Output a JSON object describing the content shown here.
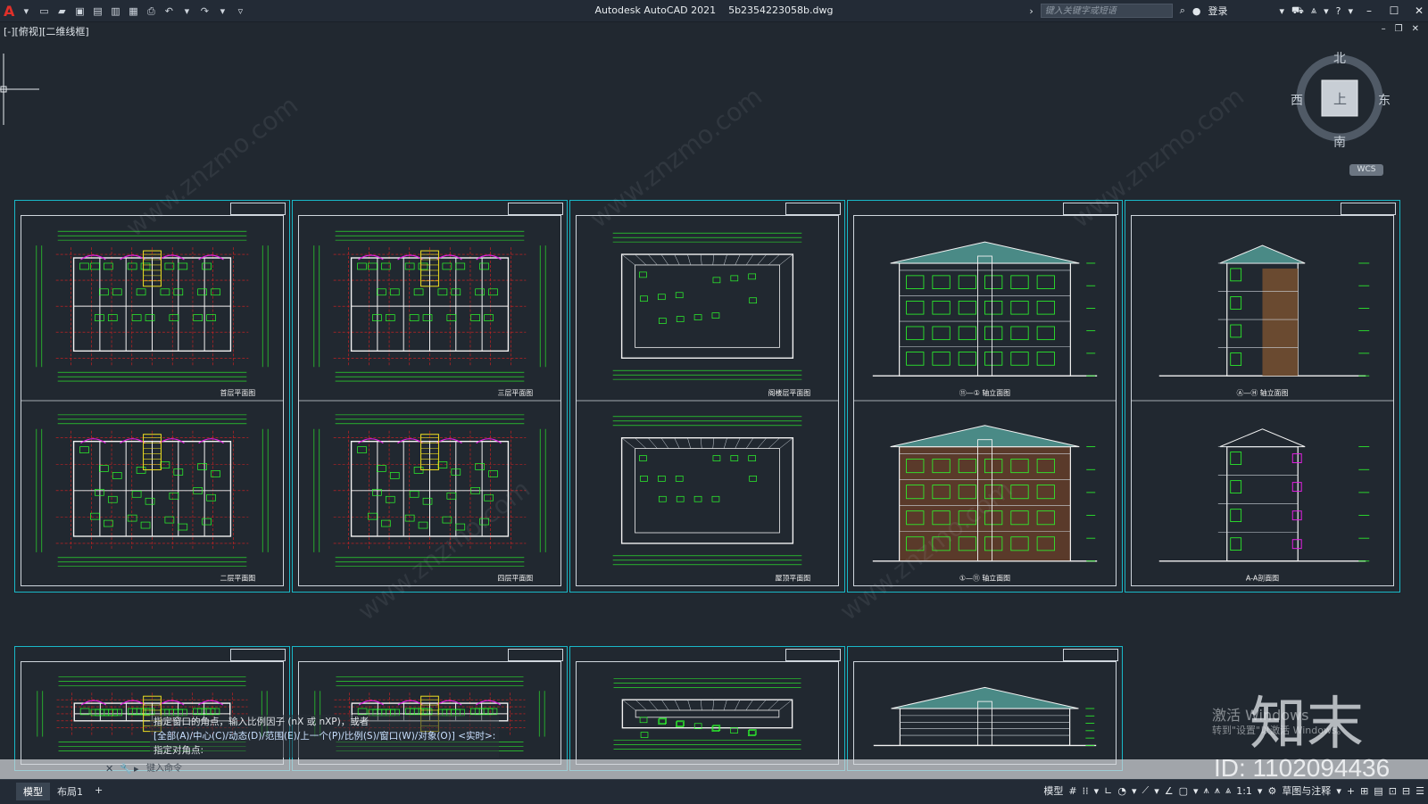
{
  "app": {
    "title": "Autodesk AutoCAD 2021",
    "file": "5b2354223058b.dwg",
    "logo": "A"
  },
  "quick_access": [
    "new-icon",
    "open-icon",
    "save-icon",
    "saveas-icon",
    "plot-preview-icon",
    "publish-icon",
    "print-icon",
    "undo-icon",
    "redo-icon",
    "customize-icon"
  ],
  "search": {
    "placeholder": "键入关键字或短语"
  },
  "login_label": "登录",
  "viewport_label": "[-][俯视][二维线框]",
  "viewcube": {
    "north": "北",
    "south": "南",
    "east": "东",
    "west": "西",
    "top": "上",
    "wcs": "WCS"
  },
  "sheets_row1": [
    {
      "caption_top": "首层平面图",
      "caption_bottom": "二层平面图"
    },
    {
      "caption_top": "三层平面图",
      "caption_bottom": "四层平面图"
    },
    {
      "caption_top": "阁楼层平面图",
      "caption_bottom": "屋顶平面图"
    },
    {
      "caption_top": "⑪—① 轴立面图",
      "caption_bottom": "①—⑪ 轴立面图"
    },
    {
      "caption_top": "Ⓐ—Ⓗ 轴立面图",
      "caption_bottom": "A-A剖面图"
    }
  ],
  "command": {
    "history": [
      "指定窗口的角点，输入比例因子 (nX 或 nXP)，或者",
      "[全部(A)/中心(C)/动态(D)/范围(E)/上一个(P)/比例(S)/窗口(W)/对象(O)] <实时>:",
      "指定对角点:"
    ],
    "input_placeholder": "键入命令"
  },
  "layout_tabs": [
    "模型",
    "布局1",
    "+"
  ],
  "status": {
    "model": "模型",
    "scale": "1:1",
    "workspace": "草图与注释"
  },
  "overlay": {
    "activate_line1": "激活 Windows",
    "activate_line2": "转到\"设置\"以激活 Windows。",
    "brand": "知末",
    "id": "ID: 1102094436",
    "watermark": "www.znzmo.com"
  },
  "colors": {
    "accent_cyan": "#19b8c7",
    "cad_green": "#2cff2c",
    "cad_red": "#e02020",
    "cad_magenta": "#e020e0",
    "cad_yellow": "#f0e020"
  }
}
